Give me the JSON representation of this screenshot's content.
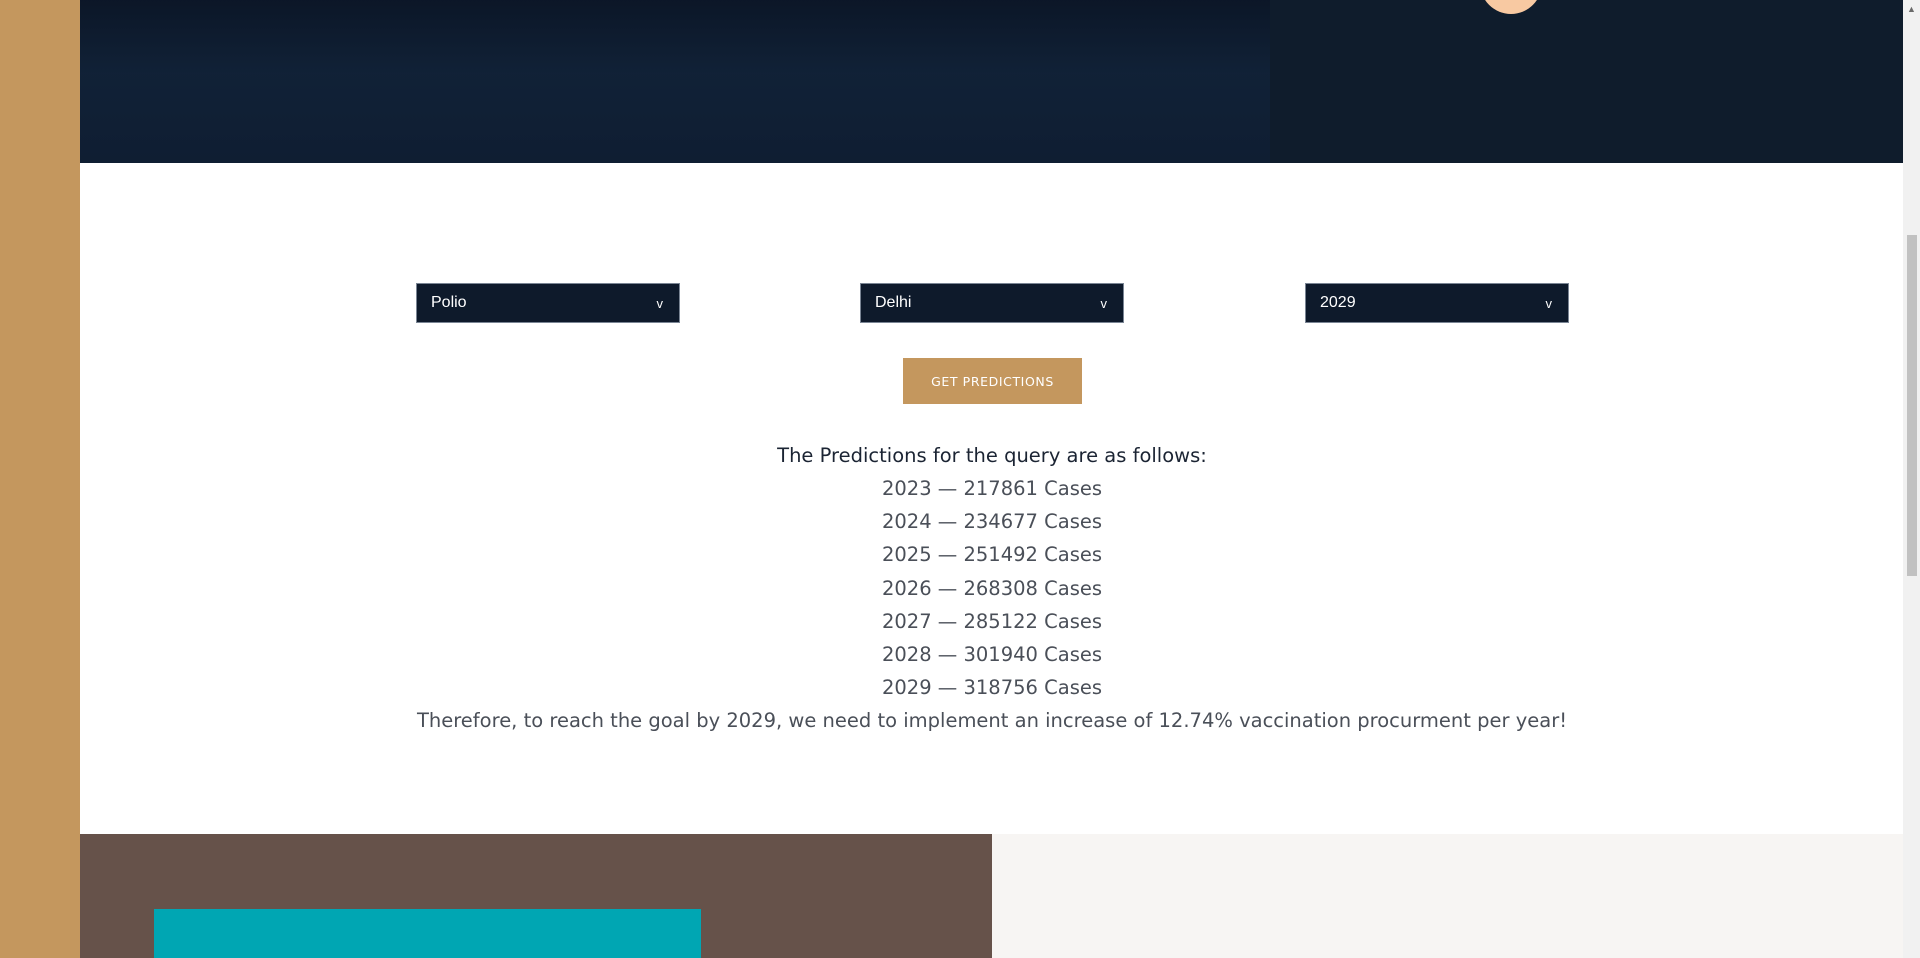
{
  "colors": {
    "accent": "#C4975E",
    "navy": "#0E1A2B",
    "brown": "#66524A",
    "teal": "#00A6B3",
    "offwhite": "#F7F5F3"
  },
  "form": {
    "disease": "Polio",
    "region": "Delhi",
    "year": "2029",
    "chevron": "v",
    "submit_label": "GET PREDICTIONS"
  },
  "results": {
    "heading": "The Predictions for the query are as follows:",
    "lines": [
      "2023 — 217861 Cases",
      "2024 — 234677 Cases",
      "2025 — 251492 Cases",
      "2026 — 268308 Cases",
      "2027 — 285122 Cases",
      "2028 — 301940 Cases",
      "2029 — 318756 Cases"
    ],
    "conclusion": "Therefore, to reach the goal by 2029, we need to implement an increase of 12.74% vaccination procurment per year!"
  },
  "scrollbar": {
    "up_arrow": "▲"
  }
}
